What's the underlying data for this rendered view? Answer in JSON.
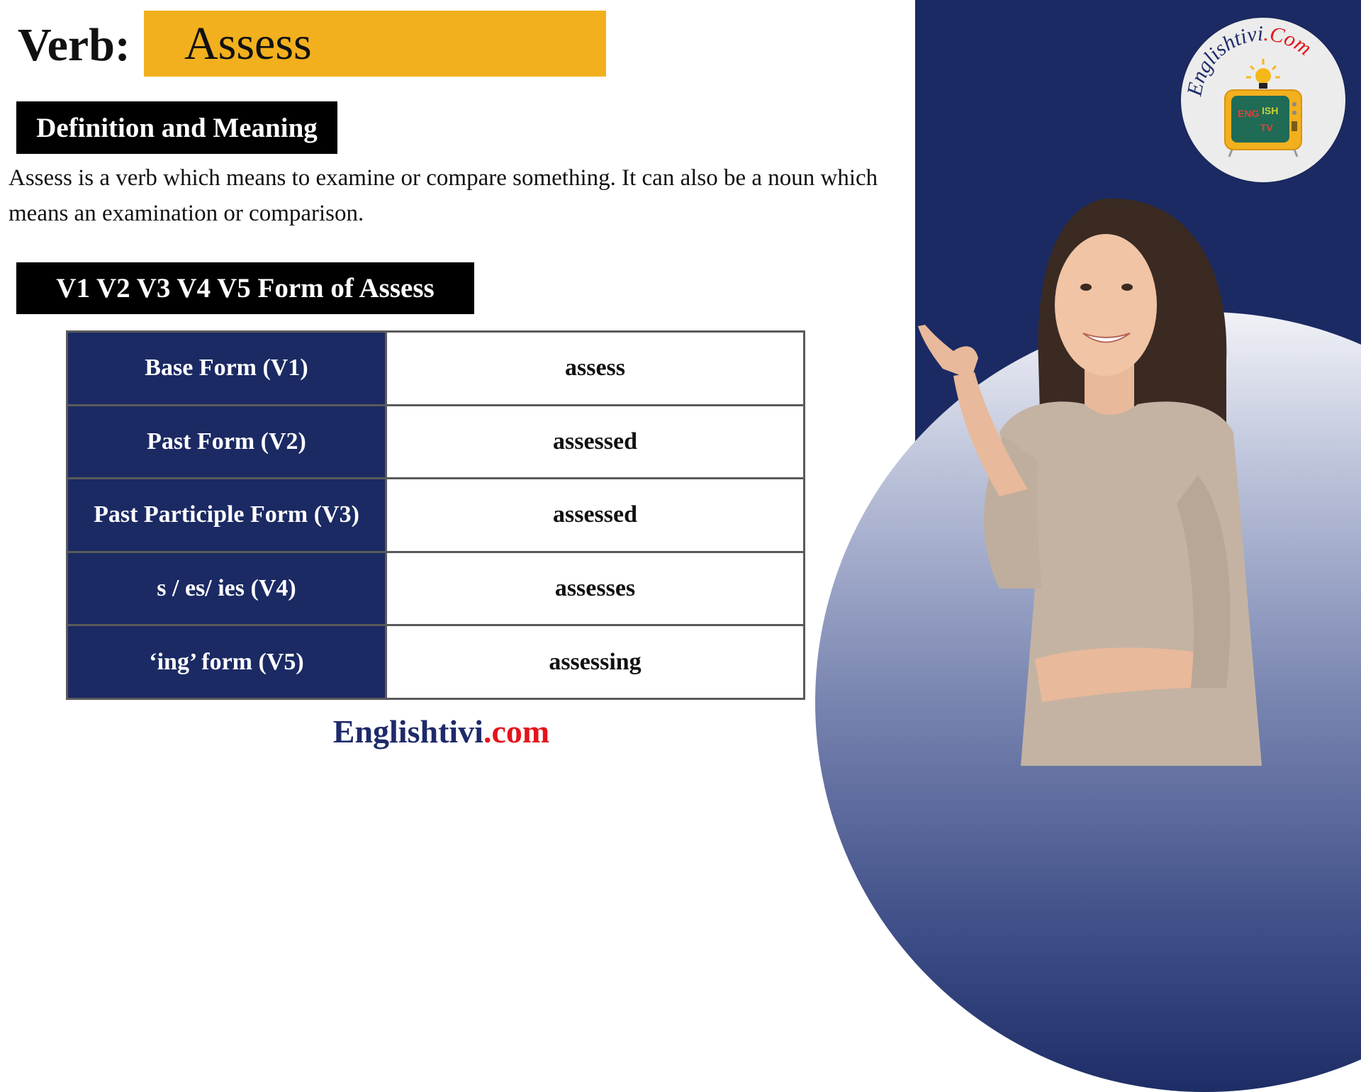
{
  "header": {
    "label": "Verb:",
    "word": "Assess"
  },
  "definition": {
    "heading": "Definition and Meaning",
    "text": "Assess is a verb which means to examine or compare something. It can also be a noun which means an examination or comparison."
  },
  "forms": {
    "heading": "V1 V2 V3 V4 V5 Form of Assess",
    "rows": [
      {
        "label": "Base Form (V1)",
        "value": "assess"
      },
      {
        "label": "Past Form (V2)",
        "value": "assessed"
      },
      {
        "label": "Past Participle Form (V3)",
        "value": "assessed"
      },
      {
        "label": "s / es/ ies (V4)",
        "value": "assesses"
      },
      {
        "label": "‘ing’ form (V5)",
        "value": "assessing"
      }
    ]
  },
  "footer": {
    "brand": "Englishtivi",
    "tld": ".com"
  },
  "logo": {
    "brand": "Englishtivi",
    "tld": ".Com",
    "icon": "tv-lightbulb-icon"
  },
  "colors": {
    "accent_yellow": "#f2b01e",
    "navy": "#1b2a63",
    "brand_red": "#e4141b"
  }
}
